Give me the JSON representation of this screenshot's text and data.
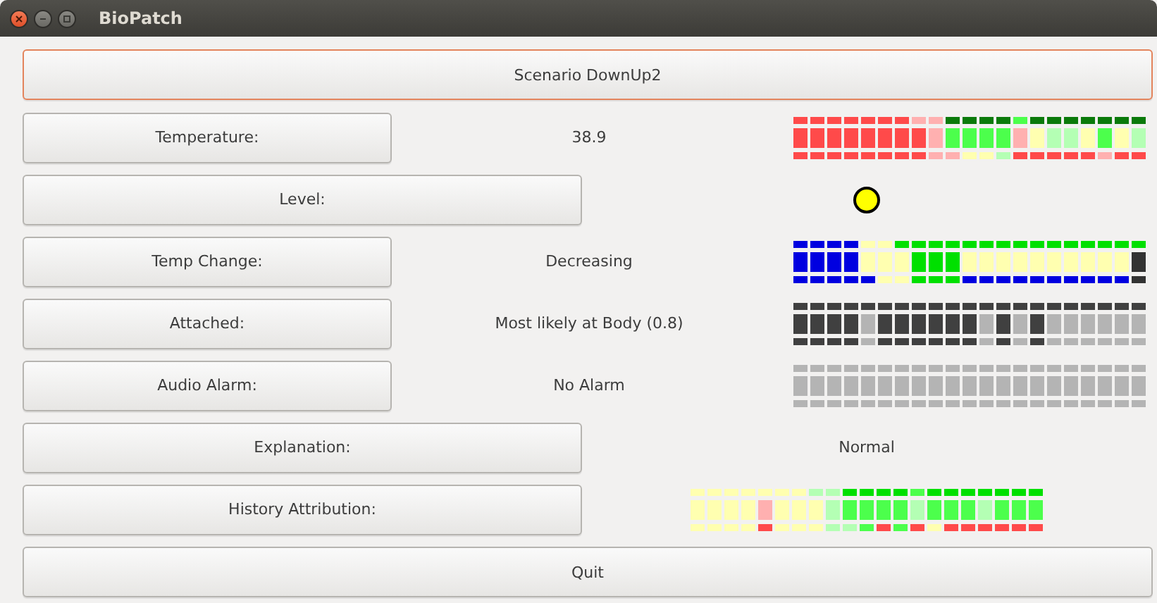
{
  "window": {
    "title": "BioPatch"
  },
  "scenario_button": {
    "label": "Scenario DownUp2",
    "focused": true
  },
  "rows": [
    {
      "label": "Temperature:",
      "kind": "reading",
      "value": "38.9"
    },
    {
      "label": "Level:",
      "kind": "indicator"
    },
    {
      "label": "Temp Change:",
      "kind": "reading",
      "value": "Decreasing"
    },
    {
      "label": "Attached:",
      "kind": "reading",
      "value": "Most likely at Body (0.8)"
    },
    {
      "label": "Audio Alarm:",
      "kind": "reading",
      "value": "No Alarm"
    },
    {
      "label": "Explanation:",
      "kind": "note",
      "value": "Normal"
    },
    {
      "label": "History Attribution:",
      "kind": "history"
    }
  ],
  "quit_button": {
    "label": "Quit",
    "focused": false
  }
}
